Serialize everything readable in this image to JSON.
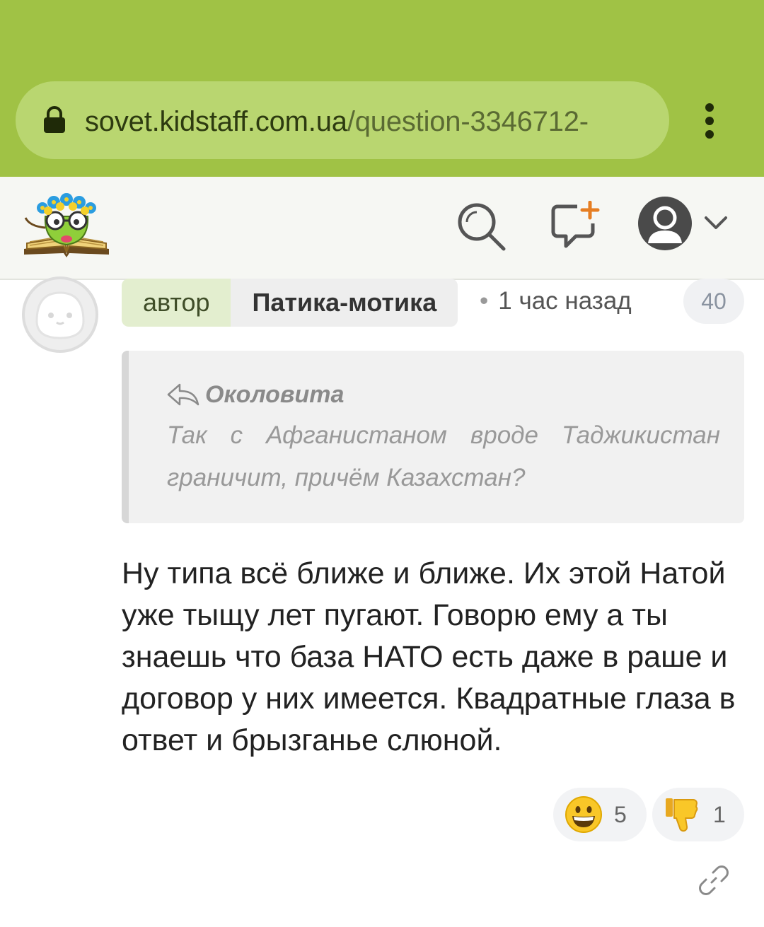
{
  "browser": {
    "url_host": "sovet.kidstaff.com.ua",
    "url_path": "/question-3346712-",
    "menu_icon": "kebab-menu-icon",
    "lock_icon": "lock-icon"
  },
  "header": {
    "logo": "kidstaff-logo",
    "icons": [
      "search-icon",
      "new-message-icon",
      "user-avatar-icon",
      "chevron-down-icon"
    ]
  },
  "post": {
    "author_tag": "автор",
    "author_name": "Патика-мотика",
    "time": "1 час назад",
    "count": "40",
    "quote": {
      "author": "Околовита",
      "text": "Так с Афганистаном вроде Таджикистан граничит, причём Казахстан?"
    },
    "body": "Ну типа всё ближе и ближе. Их этой Натой уже тыщу лет пугают. Говорю ему а ты знаешь что база НАТО есть даже в раше и договор у них имеется. Квадратные глаза в ответ и брызганье слюной.",
    "reactions": [
      {
        "icon": "grinning-face-icon",
        "count": "5"
      },
      {
        "icon": "thumbs-down-icon",
        "count": "1"
      }
    ],
    "link_icon": "link-icon"
  },
  "colors": {
    "browser_bar": "#a0c245",
    "url_field": "#b9d670",
    "author_tag_bg": "#e3eecf"
  }
}
